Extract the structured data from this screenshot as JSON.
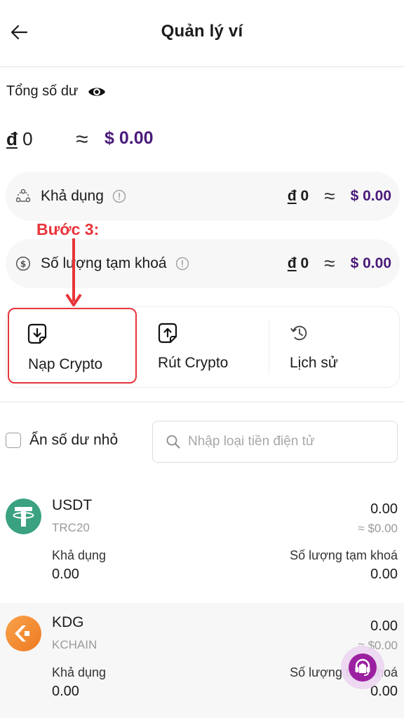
{
  "header": {
    "title": "Quản lý ví",
    "back_icon": "arrow-left-icon"
  },
  "balance": {
    "total_label": "Tổng số dư",
    "visibility_icon": "eye-icon",
    "currency_symbol": "đ",
    "vnd_value": "0",
    "approx_symbol": "≈",
    "usd_value": "$ 0.00"
  },
  "summary_rows": [
    {
      "icon": "share-nodes-icon",
      "label": "Khả dụng",
      "info_icon": "info-icon",
      "currency_symbol": "đ",
      "vnd_value": "0",
      "approx_symbol": "≈",
      "usd_value": "$ 0.00"
    },
    {
      "icon": "dollar-circle-icon",
      "label": "Số lượng tạm khoá",
      "info_icon": "info-icon",
      "currency_symbol": "đ",
      "vnd_value": "0",
      "approx_symbol": "≈",
      "usd_value": "$ 0.00"
    }
  ],
  "annotation": {
    "step_label": "Bước 3:",
    "color": "#e8353a"
  },
  "actions": [
    {
      "label": "Nạp Crypto",
      "icon": "deposit-icon",
      "highlighted": true
    },
    {
      "label": "Rút Crypto",
      "icon": "withdraw-icon",
      "highlighted": false
    },
    {
      "label": "Lịch sử",
      "icon": "history-icon",
      "highlighted": false
    }
  ],
  "filters": {
    "hide_small_label": "Ẩn số dư nhỏ",
    "hide_small_checked": false,
    "search_placeholder": "Nhập loại tiền điện tử",
    "search_value": ""
  },
  "assets": [
    {
      "symbol": "USDT",
      "network": "TRC20",
      "amount": "0.00",
      "usd_value": "≈ $0.00",
      "available_label": "Khả dụng",
      "available_value": "0.00",
      "locked_label": "Số lượng tạm khoá",
      "locked_value": "0.00",
      "logo_color": "#3aa181"
    },
    {
      "symbol": "KDG",
      "network": "KCHAIN",
      "amount": "0.00",
      "usd_value": "≈ $0.00",
      "available_label": "Khả dụng",
      "available_value": "0.00",
      "locked_label": "Số lượng tạm khoá",
      "locked_value": "0.00",
      "logo_color": "#f28a2e"
    }
  ],
  "support": {
    "icon": "headset-icon",
    "color": "#9b1fa1"
  },
  "colors": {
    "usd_accent": "#4a1a7a",
    "annotation_red": "#e8353a"
  }
}
